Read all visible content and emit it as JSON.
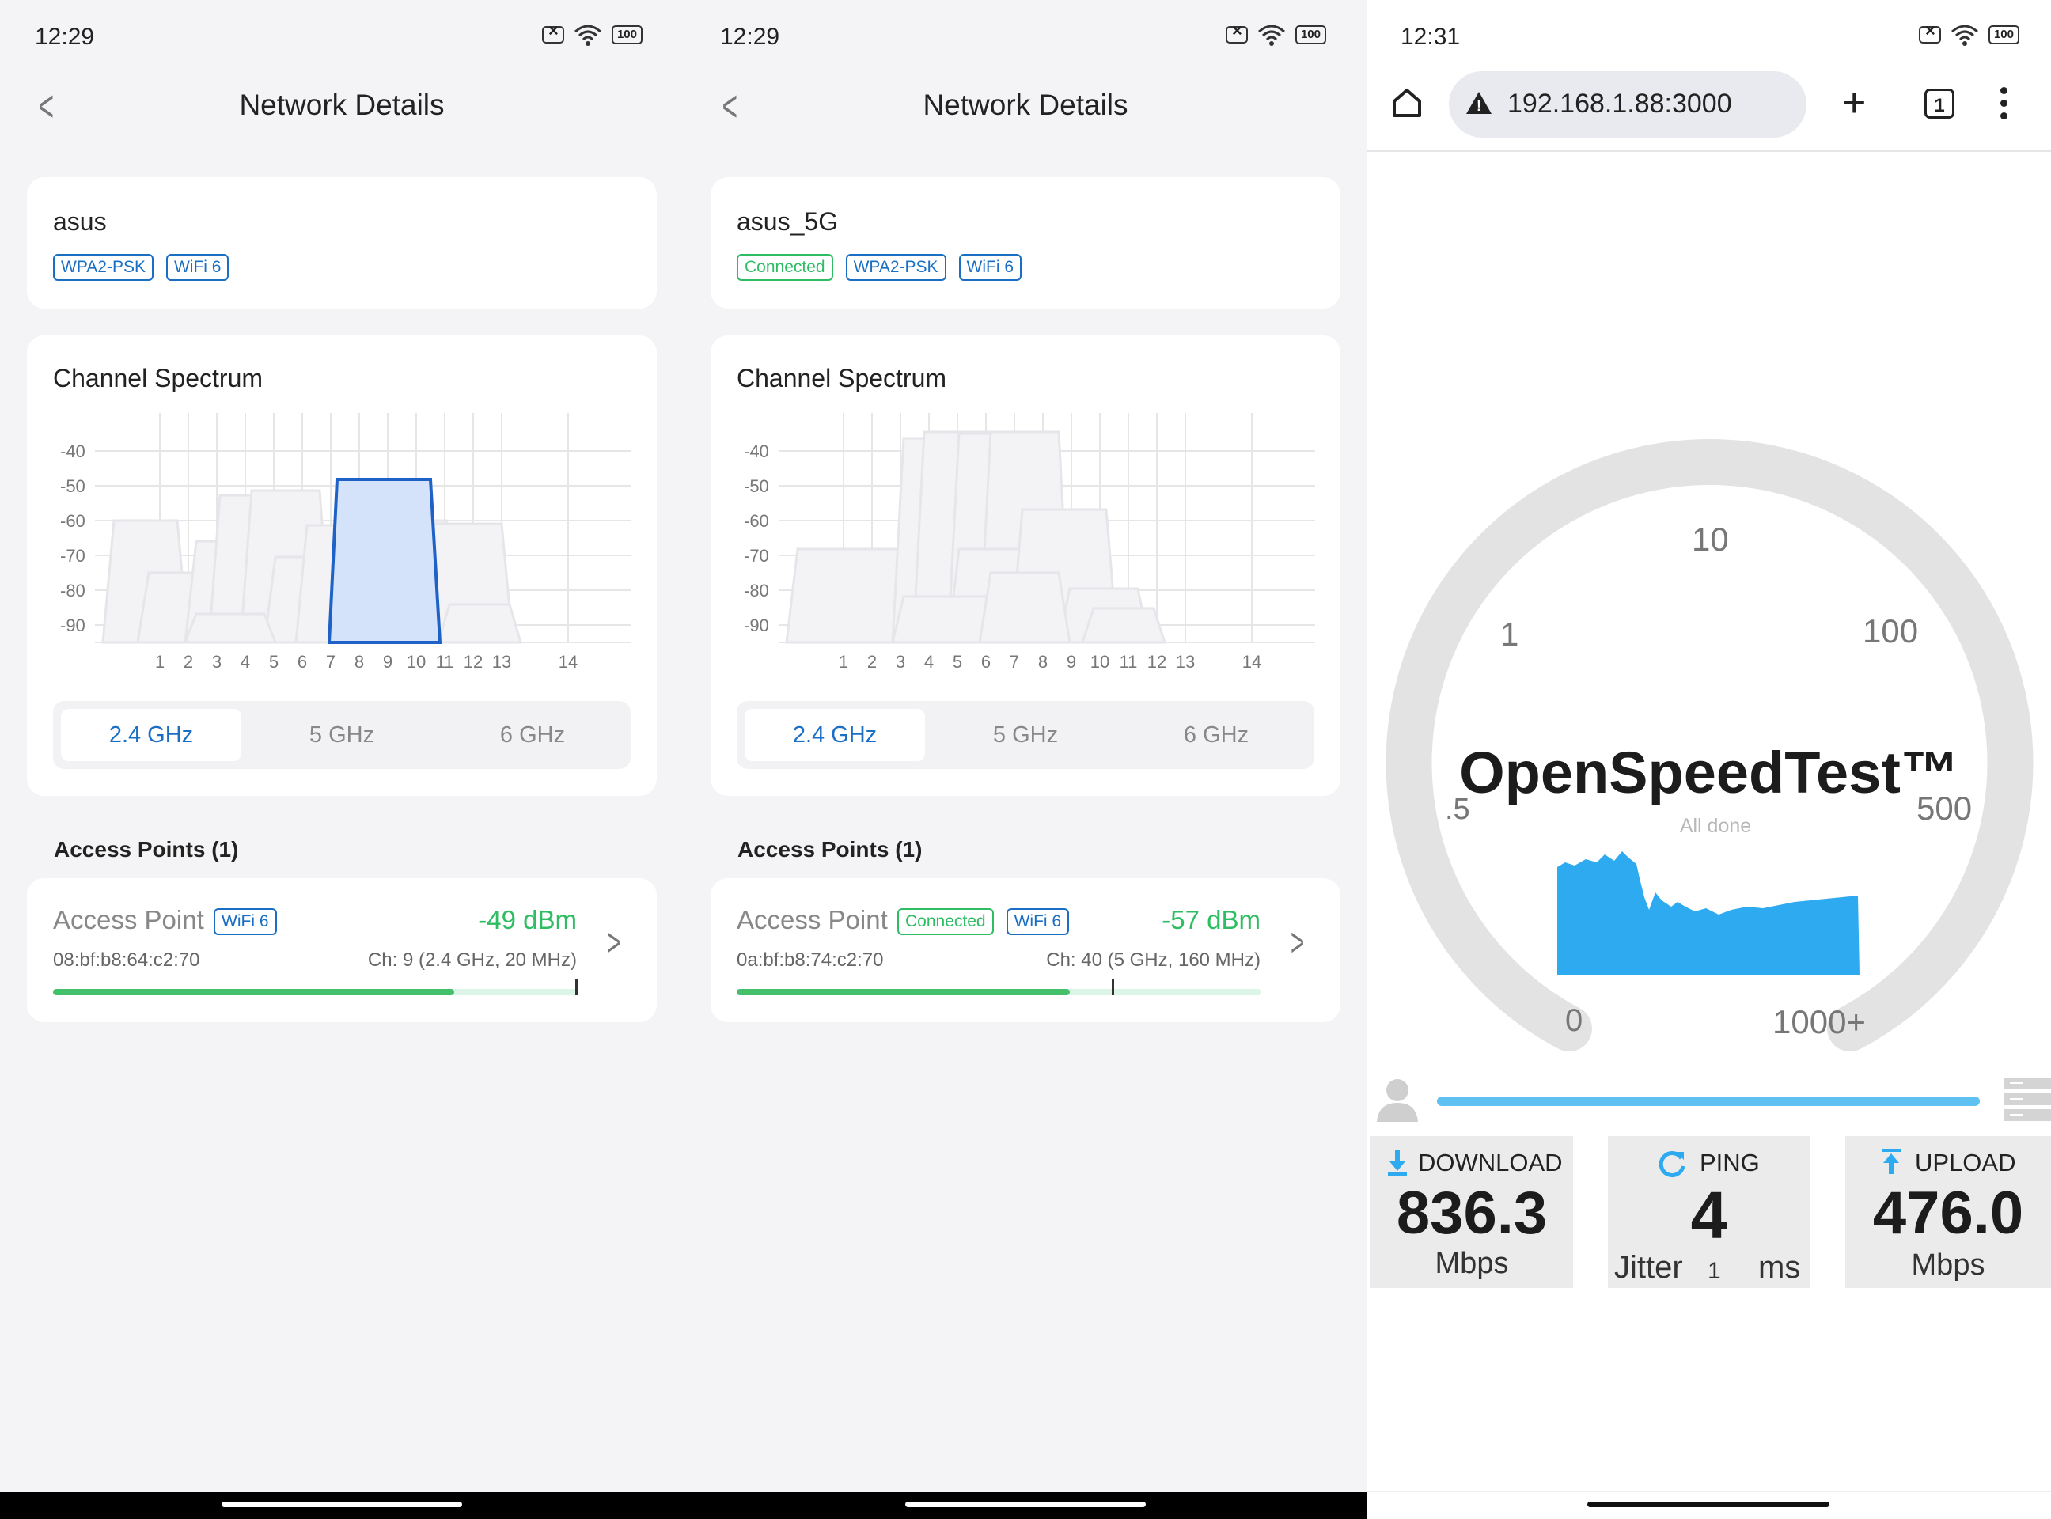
{
  "panel1": {
    "status": {
      "time": "12:29",
      "battery": "100"
    },
    "title": "Network Details",
    "network": {
      "ssid": "asus",
      "tags": [
        "WPA2-PSK",
        "WiFi 6"
      ]
    },
    "spectrum": {
      "heading": "Channel Spectrum",
      "y_ticks": [
        "-40",
        "-50",
        "-60",
        "-70",
        "-80",
        "-90"
      ],
      "x_ticks": [
        "1",
        "2",
        "3",
        "4",
        "5",
        "6",
        "7",
        "8",
        "9",
        "10",
        "11",
        "12",
        "13",
        "14"
      ],
      "bands": [
        "2.4 GHz",
        "5 GHz",
        "6 GHz"
      ],
      "selected_band": "2.4 GHz"
    },
    "access_points_heading": "Access Points (1)",
    "access_point": {
      "name": "Access Point",
      "tags": [
        "WiFi 6"
      ],
      "signal": "-49 dBm",
      "mac": "08:bf:b8:64:c2:70",
      "channel": "Ch: 9 (2.4 GHz, 20 MHz)",
      "signal_fraction": 0.765,
      "marker_fraction": 1.0
    }
  },
  "panel2": {
    "status": {
      "time": "12:29",
      "battery": "100"
    },
    "title": "Network Details",
    "network": {
      "ssid": "asus_5G",
      "status_tag": "Connected",
      "tags": [
        "WPA2-PSK",
        "WiFi 6"
      ]
    },
    "spectrum": {
      "heading": "Channel Spectrum",
      "y_ticks": [
        "-40",
        "-50",
        "-60",
        "-70",
        "-80",
        "-90"
      ],
      "x_ticks": [
        "1",
        "2",
        "3",
        "4",
        "5",
        "6",
        "7",
        "8",
        "9",
        "10",
        "11",
        "12",
        "13",
        "14"
      ],
      "bands": [
        "2.4 GHz",
        "5 GHz",
        "6 GHz"
      ],
      "selected_band": "2.4 GHz"
    },
    "access_points_heading": "Access Points (1)",
    "access_point": {
      "name": "Access Point",
      "status_tag": "Connected",
      "tags": [
        "WiFi 6"
      ],
      "signal": "-57 dBm",
      "mac": "0a:bf:b8:74:c2:70",
      "channel": "Ch: 40 (5 GHz, 160 MHz)",
      "signal_fraction": 0.635,
      "marker_fraction": 0.72
    }
  },
  "browser": {
    "status": {
      "time": "12:31",
      "battery": "100"
    },
    "url": "192.168.1.88:3000",
    "tab_count": "1",
    "gauge_labels": [
      "0",
      ".5",
      "1",
      "10",
      "100",
      "500",
      "1000+"
    ],
    "app_title": "OpenSpeedTest™",
    "status_text": "All done",
    "download": {
      "label": "DOWNLOAD",
      "value": "836.3",
      "unit": "Mbps"
    },
    "ping": {
      "label": "PING",
      "value": "4",
      "jitter_label": "Jitter",
      "jitter_value": "1",
      "unit": "ms"
    },
    "upload": {
      "label": "UPLOAD",
      "value": "476.0",
      "unit": "Mbps"
    },
    "colors": {
      "accent": "#33aaee",
      "gauge_track": "#e3e3e3"
    }
  },
  "colors": {
    "brand_blue": "#1a6fc4",
    "green": "#2ebd63"
  }
}
